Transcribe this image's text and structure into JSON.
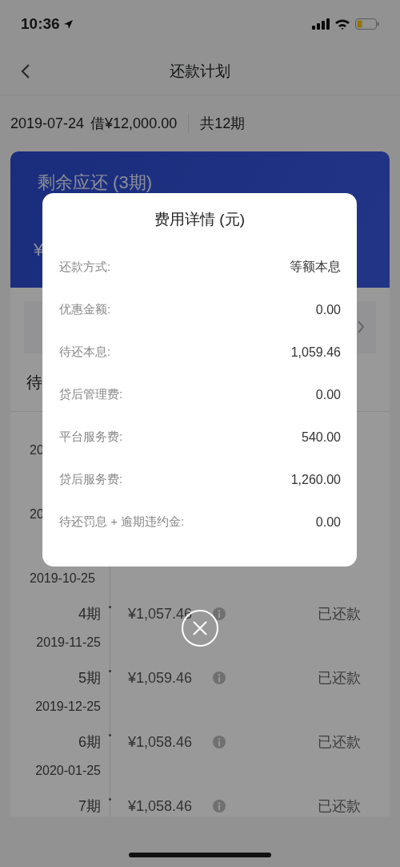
{
  "status_bar": {
    "time": "10:36"
  },
  "nav": {
    "title": "还款计划"
  },
  "loan_info": {
    "date": "2019-07-24",
    "amount": "借¥12,000.00",
    "term": "共12期"
  },
  "summary_card": {
    "title": "剩余应还 (3期)",
    "amount": "¥"
  },
  "schedule": {
    "heading": "待",
    "rows": [
      {
        "date": "20"
      },
      {
        "date": "20"
      },
      {
        "date": "2019-10-25"
      },
      {
        "period": "4期",
        "amount": "¥1,057.46",
        "status": "已还款",
        "date": "2019-11-25"
      },
      {
        "period": "5期",
        "amount": "¥1,059.46",
        "status": "已还款",
        "date": "2019-12-25"
      },
      {
        "period": "6期",
        "amount": "¥1,058.46",
        "status": "已还款",
        "date": "2020-01-25"
      },
      {
        "period": "7期",
        "amount": "¥1,058.46",
        "status": "已还款"
      }
    ]
  },
  "fee_dialog": {
    "title": "费用详情 (元)",
    "items": [
      {
        "label": "还款方式:",
        "value": "等额本息"
      },
      {
        "label": "优惠金额:",
        "value": "0.00"
      },
      {
        "label": "待还本息:",
        "value": "1,059.46"
      },
      {
        "label": "贷后管理费:",
        "value": "0.00"
      },
      {
        "label": "平台服务费:",
        "value": "540.00"
      },
      {
        "label": "贷后服务费:",
        "value": "1,260.00"
      },
      {
        "label": "待还罚息 + 逾期违约金:",
        "value": "0.00"
      }
    ]
  }
}
